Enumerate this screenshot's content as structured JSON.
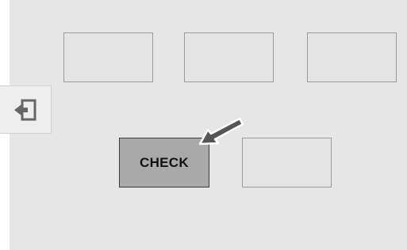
{
  "check_button": {
    "label": "CHECK"
  },
  "icons": {
    "side_tab": "exit-door-icon",
    "pointer": "pointer-arrow-icon"
  },
  "colors": {
    "background": "#e6e6e6",
    "box_border": "#9a9a9a",
    "check_fill": "#a9a9a9",
    "check_border": "#3c3c3c",
    "arrow": "#555555"
  }
}
